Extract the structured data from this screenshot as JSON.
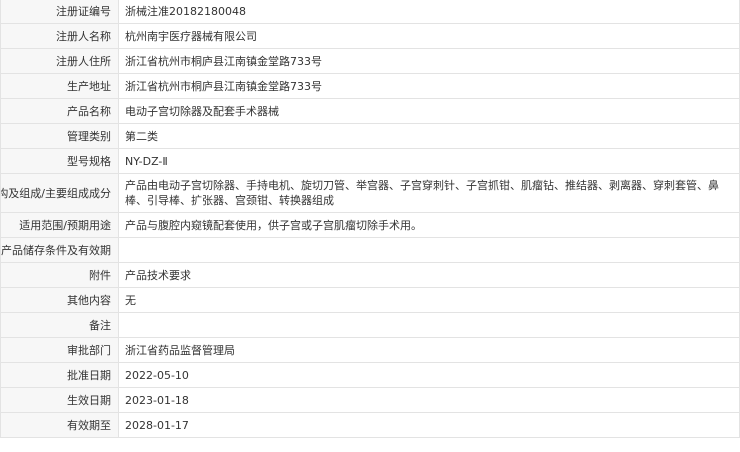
{
  "rows": [
    {
      "label": "注册证编号",
      "value": "浙械注准20182180048"
    },
    {
      "label": "注册人名称",
      "value": "杭州南宇医疗器械有限公司"
    },
    {
      "label": "注册人住所",
      "value": "浙江省杭州市桐庐县江南镇金堂路733号"
    },
    {
      "label": "生产地址",
      "value": "浙江省杭州市桐庐县江南镇金堂路733号"
    },
    {
      "label": "产品名称",
      "value": "电动子宫切除器及配套手术器械"
    },
    {
      "label": "管理类别",
      "value": "第二类"
    },
    {
      "label": "型号规格",
      "value": "NY-DZ-Ⅱ"
    },
    {
      "label": "结构及组成/主要组成成分",
      "value": "产品由电动子宫切除器、手持电机、旋切刀管、举宫器、子宫穿刺针、子宫抓钳、肌瘤钻、推结器、剥离器、穿刺套管、鼻棒、引导棒、扩张器、宫颈钳、转换器组成"
    },
    {
      "label": "适用范围/预期用途",
      "value": "产品与腹腔内窥镜配套使用，供子宫或子宫肌瘤切除手术用。"
    },
    {
      "label": "产品储存条件及有效期",
      "value": ""
    },
    {
      "label": "附件",
      "value": "产品技术要求"
    },
    {
      "label": "其他内容",
      "value": "无"
    },
    {
      "label": "备注",
      "value": ""
    },
    {
      "label": "审批部门",
      "value": "浙江省药品监督管理局"
    },
    {
      "label": "批准日期",
      "value": "2022-05-10"
    },
    {
      "label": "生效日期",
      "value": "2023-01-18"
    },
    {
      "label": "有效期至",
      "value": "2028-01-17"
    }
  ]
}
